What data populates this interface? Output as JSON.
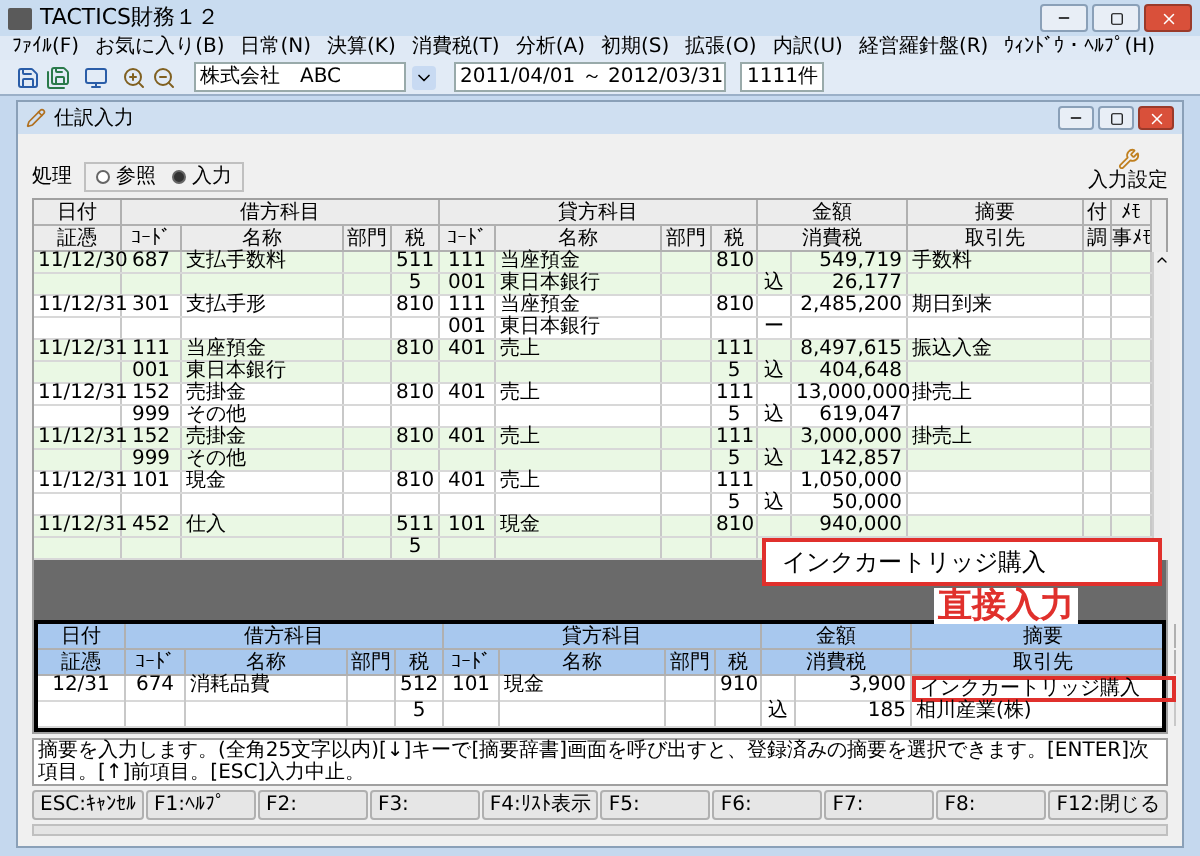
{
  "app": {
    "title": "TACTICS財務１２"
  },
  "menu": [
    "ﾌｧｲﾙ(F)",
    "お気に入り(B)",
    "日常(N)",
    "決算(K)",
    "消費税(T)",
    "分析(A)",
    "初期(S)",
    "拡張(O)",
    "内訳(U)",
    "経営羅針盤(R)",
    "ｳｨﾝﾄﾞｳ・ﾍﾙﾌﾟ(H)"
  ],
  "toolbar": {
    "company": "株式会社　ABC",
    "period": "2011/04/01 ～ 2012/03/31",
    "count": "1111件"
  },
  "window": {
    "title": "仕訳入力",
    "settings_button": "入力設定",
    "mode_label": "処理",
    "modes": [
      {
        "label": "参照",
        "selected": false
      },
      {
        "label": "入力",
        "selected": true
      }
    ]
  },
  "journal": {
    "header_top": [
      "日付",
      "借方科目",
      "貸方科目",
      "金額",
      "摘要",
      "付",
      "ﾒﾓ"
    ],
    "header_bottom": [
      "証憑",
      "ｺｰﾄﾞ",
      "名称",
      "部門",
      "税",
      "ｺｰﾄﾞ",
      "名称",
      "部門",
      "税",
      "消費税",
      "取引先",
      "調",
      "事ﾒﾓ"
    ],
    "entries": [
      {
        "lines": [
          {
            "date": "11/12/30",
            "d_code": "687",
            "d_name": "支払手数料",
            "d_tax": "511",
            "c_code": "111",
            "c_name": "当座預金",
            "c_tax": "810",
            "amount": "549,719",
            "summary": "手数料"
          },
          {
            "d_tax": "5",
            "c_code": "001",
            "c_name": "東日本銀行",
            "mark": "込",
            "amount": "26,177"
          }
        ]
      },
      {
        "lines": [
          {
            "date": "11/12/31",
            "d_code": "301",
            "d_name": "支払手形",
            "d_tax": "810",
            "c_code": "111",
            "c_name": "当座預金",
            "c_tax": "810",
            "amount": "2,485,200",
            "summary": "期日到来"
          },
          {
            "c_code": "001",
            "c_name": "東日本銀行",
            "mark": "ー"
          }
        ]
      },
      {
        "lines": [
          {
            "date": "11/12/31",
            "d_code": "111",
            "d_name": "当座預金",
            "d_tax": "810",
            "c_code": "401",
            "c_name": "売上",
            "c_tax": "111",
            "amount": "8,497,615",
            "summary": "振込入金"
          },
          {
            "d_code": "001",
            "d_name": "東日本銀行",
            "c_tax": "5",
            "mark": "込",
            "amount": "404,648"
          }
        ]
      },
      {
        "lines": [
          {
            "date": "11/12/31",
            "d_code": "152",
            "d_name": "売掛金",
            "d_tax": "810",
            "c_code": "401",
            "c_name": "売上",
            "c_tax": "111",
            "amount": "13,000,000",
            "summary": "掛売上"
          },
          {
            "d_code": "999",
            "d_name": "その他",
            "c_tax": "5",
            "mark": "込",
            "amount": "619,047"
          }
        ]
      },
      {
        "lines": [
          {
            "date": "11/12/31",
            "d_code": "152",
            "d_name": "売掛金",
            "d_tax": "810",
            "c_code": "401",
            "c_name": "売上",
            "c_tax": "111",
            "amount": "3,000,000",
            "summary": "掛売上"
          },
          {
            "d_code": "999",
            "d_name": "その他",
            "c_tax": "5",
            "mark": "込",
            "amount": "142,857"
          }
        ]
      },
      {
        "lines": [
          {
            "date": "11/12/31",
            "d_code": "101",
            "d_name": "現金",
            "d_tax": "810",
            "c_code": "401",
            "c_name": "売上",
            "c_tax": "111",
            "amount": "1,050,000"
          },
          {
            "c_tax": "5",
            "mark": "込",
            "amount": "50,000"
          }
        ]
      },
      {
        "lines": [
          {
            "date": "11/12/31",
            "d_code": "452",
            "d_name": "仕入",
            "d_tax": "511",
            "c_code": "101",
            "c_name": "現金",
            "c_tax": "810",
            "amount": "940,000"
          },
          {
            "d_tax": "5"
          }
        ]
      }
    ]
  },
  "entry_form": {
    "header_top": [
      "日付",
      "借方科目",
      "貸方科目",
      "金額",
      "摘要"
    ],
    "header_bottom": [
      "証憑",
      "ｺｰﾄﾞ",
      "名称",
      "部門",
      "税",
      "ｺｰﾄﾞ",
      "名称",
      "部門",
      "税",
      "消費税",
      "取引先"
    ],
    "lines": [
      {
        "date": "12/31",
        "d_code": "674",
        "d_name": "消耗品費",
        "d_tax": "512",
        "c_code": "101",
        "c_name": "現金",
        "c_tax": "910",
        "amount": "3,900",
        "summary": "インクカートリッジ購入",
        "focused": true
      },
      {
        "d_tax": "5",
        "mark": "込",
        "amount": "185",
        "summary": "相川産業(株)",
        "focused": false
      }
    ]
  },
  "callout": {
    "text": "インクカートリッジ購入",
    "label": "直接入力"
  },
  "status_message": "摘要を入力します。(全角25文字以内)[↓]キーで[摘要辞書]画面を呼び出すと、登録済みの摘要を選択できます。[ENTER]次項目。[↑]前項目。[ESC]入力中止。",
  "function_keys": [
    "ESC:ｷｬﾝｾﾙ",
    "F1:ﾍﾙﾌﾟ",
    "F2:",
    "F3:",
    "F4:ﾘｽﾄ表示",
    "F5:",
    "F6:",
    "F7:",
    "F8:",
    "F12:閉じる"
  ]
}
